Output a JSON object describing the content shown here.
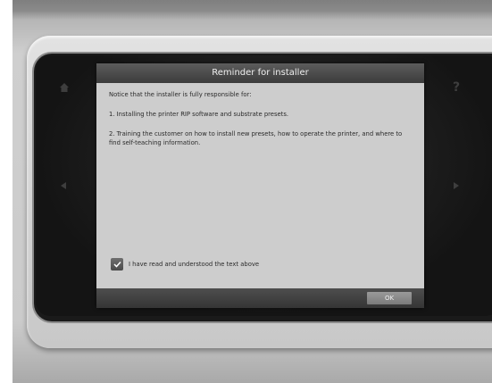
{
  "dialog": {
    "title": "Reminder for installer",
    "intro": "Notice that the installer is fully responsible for:",
    "item1": "1. Installing the printer RIP software and substrate presets.",
    "item2": "2. Training the customer on how to install new presets, how to operate the printer, and where to find self-teaching information.",
    "checkbox_label": "I have read and understood the text above",
    "checkbox_checked": true,
    "ok_label": "OK"
  },
  "side_icons": {
    "home": "home-icon",
    "help": "?",
    "back": "left-arrow-icon",
    "forward": "right-arrow-icon"
  },
  "colors": {
    "dialog_bg": "#cdcdcd",
    "title_bar": "#4a4a4a",
    "frame": "#1a1a1a"
  }
}
